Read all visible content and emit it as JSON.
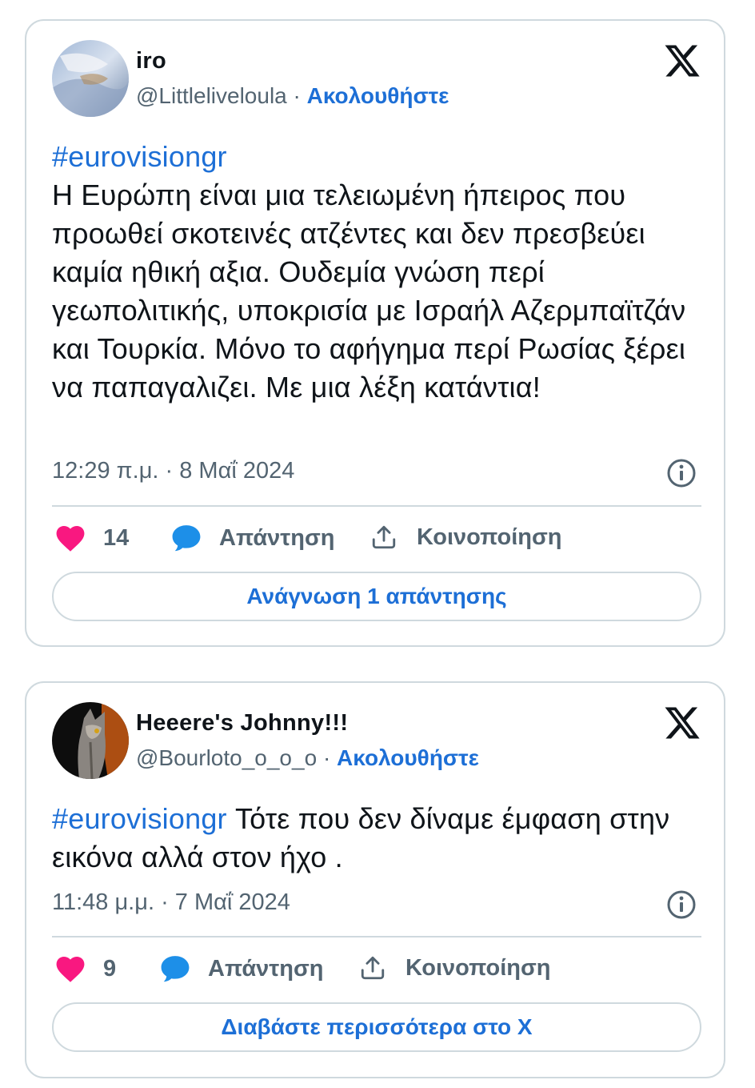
{
  "tweets": [
    {
      "display_name": "iro",
      "handle": "@Littleliveloula",
      "separator": "·",
      "follow_label": "Ακολουθήστε",
      "hashtag": "#eurovisiongr",
      "text": "Η Ευρώπη είναι μια τελειωμένη ήπειρος που προωθεί σκοτεινές ατζέντες και δεν πρεσβεύει καμία ηθική αξια. Ουδεμία γνώση περί γεωπολιτικής, υποκρισία με Ισραήλ Αζερμπαϊτζάν και Τουρκία. Μόνο το αφήγημα περί Ρωσίας ξέρει να παπαγαλιζει. Με μια λέξη κατάντια!",
      "timestamp": "12:29 π.μ. · 8 Μαΐ 2024",
      "likes": "14",
      "reply_label": "Απάντηση",
      "share_label": "Κοινοποίηση",
      "read_button_label": "Ανάγνωση 1 απάντησης"
    },
    {
      "display_name": "Heeere's Johnny!!!",
      "handle": "@Bourloto_o_o_o",
      "separator": "·",
      "follow_label": "Ακολουθήστε",
      "hashtag": "#eurovisiongr",
      "text": "Τότε που δεν δίναμε έμφαση στην εικόνα αλλά στον ήχο .",
      "timestamp": "11:48 μ.μ. · 7 Μαΐ 2024",
      "likes": "9",
      "reply_label": "Απάντηση",
      "share_label": "Κοινοποίηση",
      "read_button_label": "Διαβάστε περισσότερα στο X"
    }
  ],
  "icons": {
    "brand": "x-logo-icon",
    "like": "heart-icon",
    "reply": "speech-bubble-icon",
    "share": "share-upload-icon",
    "info": "info-icon"
  },
  "colors": {
    "accent_blue": "#1d6fd6",
    "like_pink": "#f91880",
    "muted_text": "#536471",
    "border": "#cfd9de",
    "text": "#0f1419"
  }
}
